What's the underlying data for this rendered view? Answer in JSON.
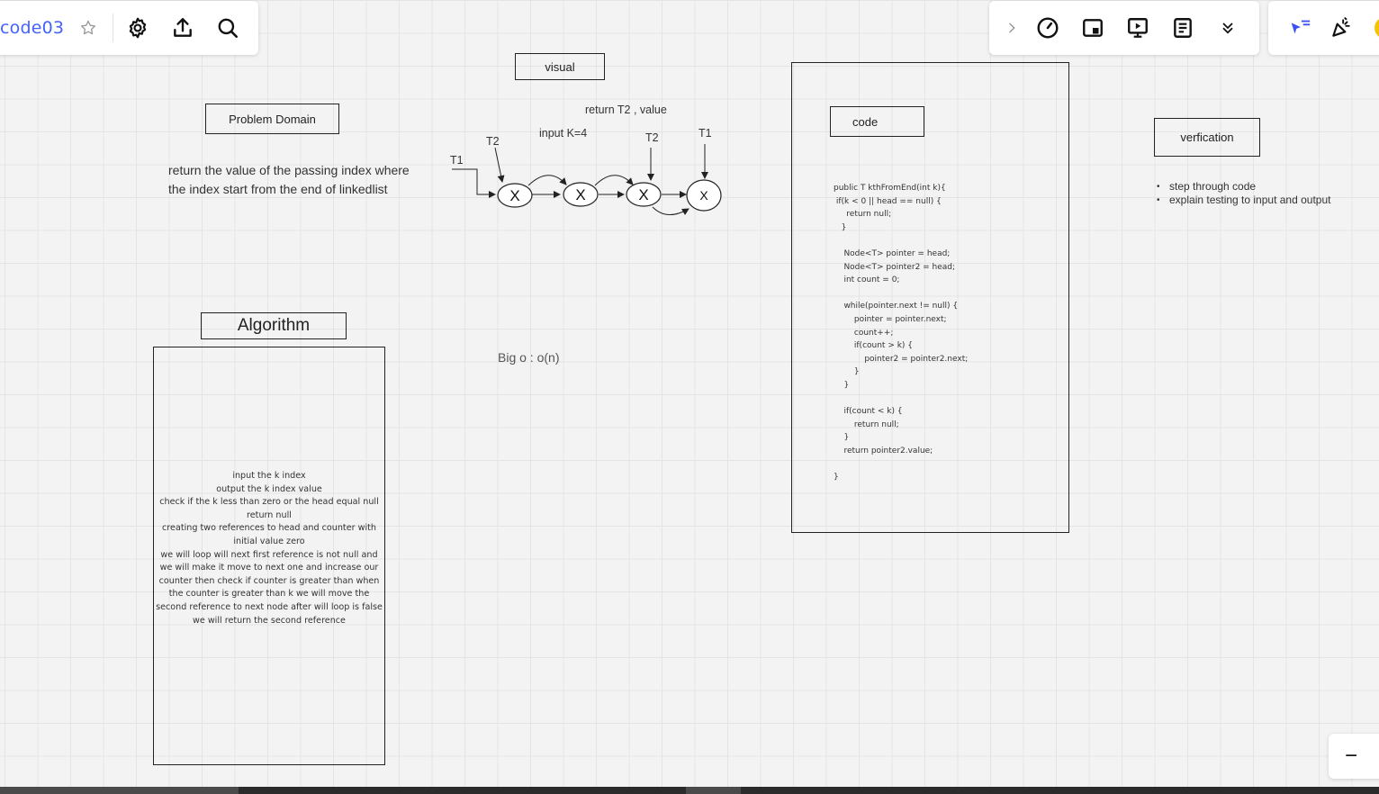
{
  "toolbar": {
    "board_title": "code03",
    "left_icons": [
      "star-icon",
      "settings-gear-icon",
      "share-upload-icon",
      "search-icon"
    ],
    "right_icons": [
      "chevron-right-icon",
      "timer-icon",
      "card-icon",
      "present-icon",
      "notes-icon",
      "double-chevron-down-icon"
    ],
    "right2_icons": [
      "cursor-flag-icon",
      "party-popper-icon"
    ],
    "zoom_out_label": "−"
  },
  "board": {
    "problem_domain": {
      "title": "Problem Domain",
      "text": "return the value of the passing index where the index start from the end of linkedlist"
    },
    "visual": {
      "title": "visual",
      "return_label": "return T2 , value",
      "input_label": "input K=4",
      "labels": [
        "T1",
        "T2",
        "T2",
        "T1"
      ],
      "node_label": "X"
    },
    "algorithm": {
      "title": "Algorithm",
      "text": "input the k index\noutput the k index value\ncheck if the k less than zero or the head equal null return null\ncreating two references to head and counter with initial value zero\nwe will loop will next first reference is not null and we will make it move to next one and increase our counter then check if counter is greater than when the counter is greater than k we will move the second reference to next node after will loop is false we will return the second reference"
    },
    "big_o": "Big o : o(n)",
    "code": {
      "title": "code",
      "text": "public T kthFromEnd(int k){\n if(k < 0 || head == null) {\n     return null;\n   }\n\n    Node<T> pointer = head;\n    Node<T> pointer2 = head;\n    int count = 0;\n\n    while(pointer.next != null) {\n        pointer = pointer.next;\n        count++;\n        if(count > k) {\n            pointer2 = pointer2.next;\n        }\n    }\n\n    if(count < k) {\n        return null;\n    }\n    return pointer2.value;\n\n}"
    },
    "verification": {
      "title": "verfication",
      "items": [
        "step through code",
        "explain testing to input and output"
      ]
    }
  }
}
